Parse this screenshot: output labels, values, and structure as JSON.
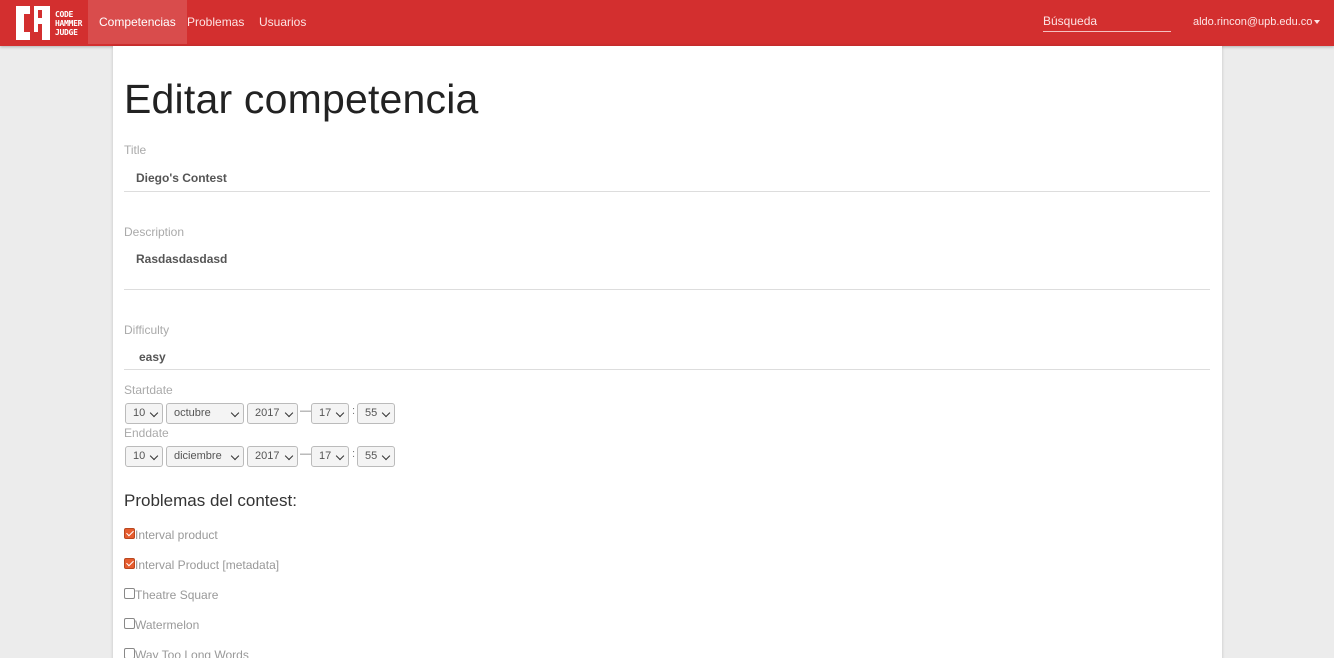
{
  "nav": {
    "logo_lines": [
      "CODE",
      "HAMMER",
      "JUDGE"
    ],
    "items": [
      {
        "label": "Competencias",
        "active": true
      },
      {
        "label": "Problemas",
        "active": false
      },
      {
        "label": "Usuarios",
        "active": false
      }
    ],
    "search_placeholder": "Búsqueda",
    "user": "aldo.rincon@upb.edu.co",
    "brand_color": "#d32f2f"
  },
  "form": {
    "heading": "Editar competencia",
    "title_label": "Title",
    "title_value": "Diego's Contest",
    "description_label": "Description",
    "description_value": "Rasdasdasdasd",
    "difficulty_label": "Difficulty",
    "difficulty_value": "easy",
    "startdate_label": "Startdate",
    "startdate": {
      "day": "10",
      "month": "octubre",
      "year": "2017",
      "hour": "17",
      "minute": "55"
    },
    "enddate_label": "Enddate",
    "enddate": {
      "day": "10",
      "month": "diciembre",
      "year": "2017",
      "hour": "17",
      "minute": "55"
    },
    "date_time_separator": "—",
    "time_separator": ":",
    "problems_heading": "Problemas del contest:",
    "problems": [
      {
        "label": "Interval product",
        "checked": true
      },
      {
        "label": "Interval Product [metadata]",
        "checked": true
      },
      {
        "label": "Theatre Square",
        "checked": false
      },
      {
        "label": "Watermelon",
        "checked": false
      },
      {
        "label": "Way Too Long Words",
        "checked": false
      }
    ]
  }
}
